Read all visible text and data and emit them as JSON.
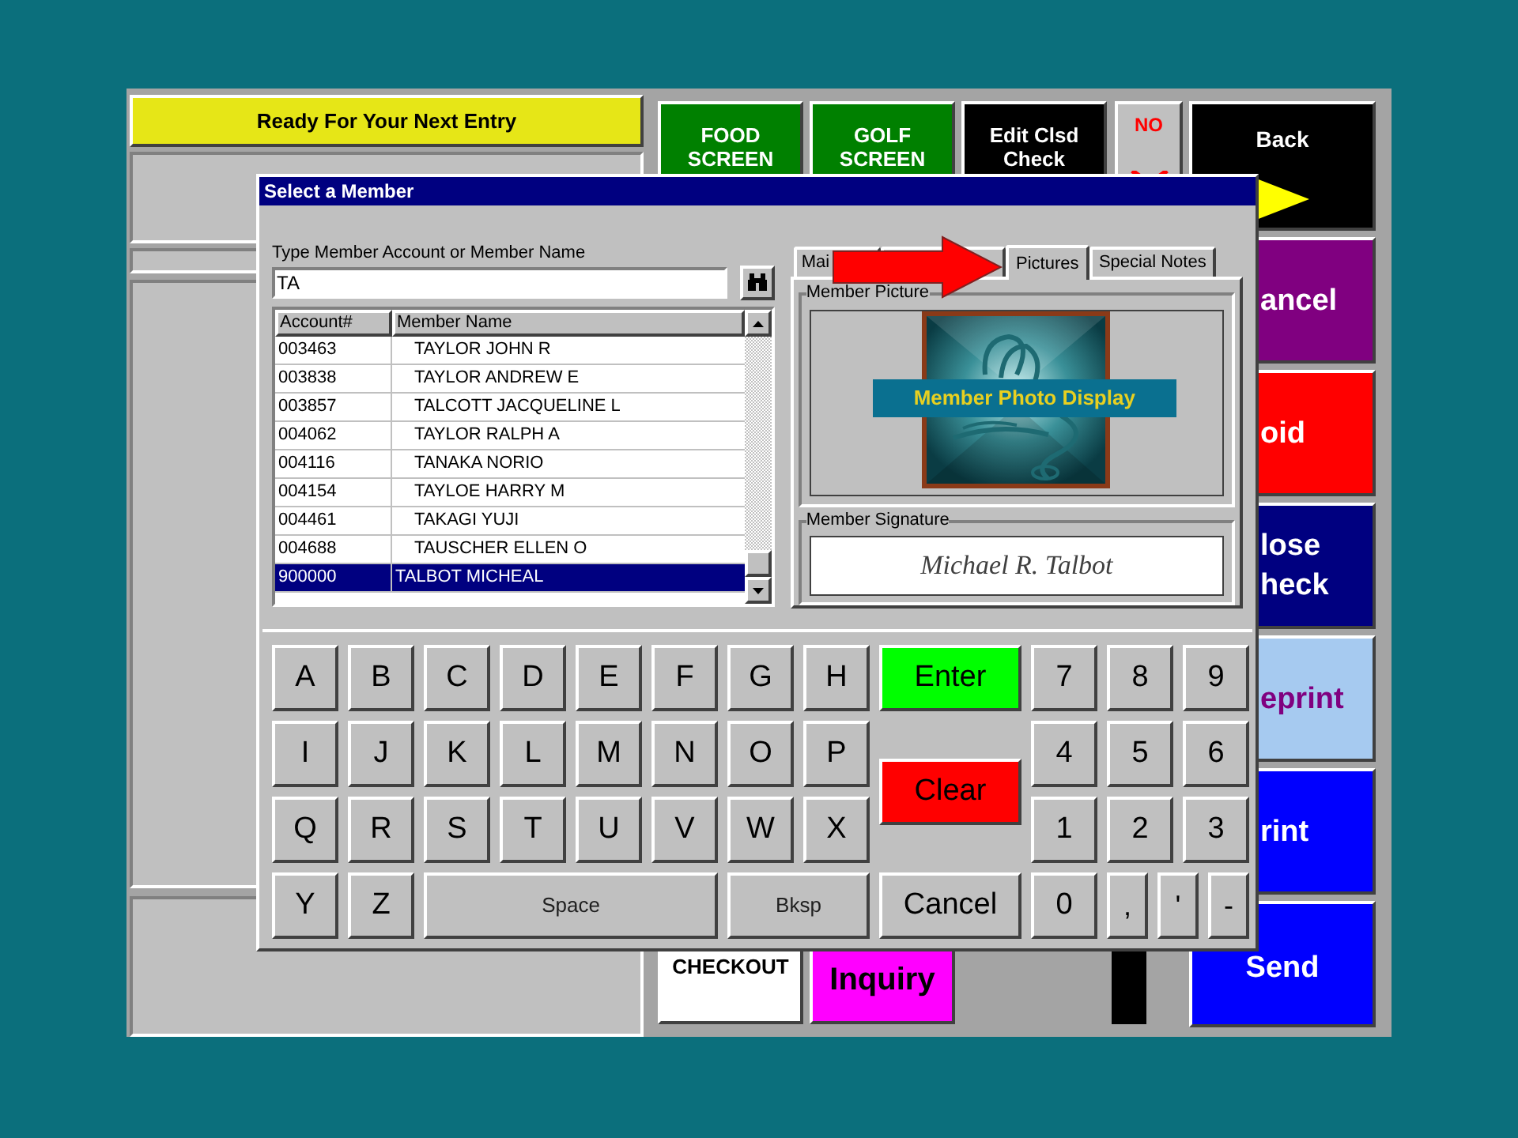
{
  "status": "Ready For Your Next Entry",
  "top_buttons": [
    {
      "lines": [
        "FOOD",
        "SCREEN"
      ],
      "kind": "green"
    },
    {
      "lines": [
        "GOLF",
        "SCREEN"
      ],
      "kind": "green"
    },
    {
      "lines": [
        "Edit Clsd",
        "Check"
      ],
      "kind": "black"
    }
  ],
  "no_button": {
    "label": "NO"
  },
  "back_button": {
    "label": "Back"
  },
  "side_buttons": [
    {
      "lines": [
        "ancel"
      ],
      "kind": "purple",
      "cut": true
    },
    {
      "lines": [
        "oid"
      ],
      "kind": "red",
      "cut": true
    },
    {
      "lines": [
        "lose",
        "heck"
      ],
      "kind": "navy",
      "cut": true
    },
    {
      "lines": [
        "eprint"
      ],
      "kind": "light",
      "cut": true
    },
    {
      "lines": [
        "rint"
      ],
      "kind": "blue",
      "cut": true
    },
    {
      "lines": [
        "Send"
      ],
      "kind": "blue",
      "cut": false
    }
  ],
  "bottom_buttons": [
    {
      "lines": [
        "CHECKOUT"
      ],
      "kind": "white"
    },
    {
      "lines": [
        "Inquiry"
      ],
      "kind": "magenta"
    }
  ],
  "dialog": {
    "title": "Select a Member",
    "search": {
      "label": "Type Member Account or Member Name",
      "value": "TA"
    },
    "table": {
      "columns": [
        "Account#",
        "Member Name"
      ],
      "rows": [
        {
          "account": "003463",
          "name": "TAYLOR JOHN R",
          "selected": false
        },
        {
          "account": "003838",
          "name": "TAYLOR ANDREW E",
          "selected": false
        },
        {
          "account": "003857",
          "name": "TALCOTT JACQUELINE L",
          "selected": false
        },
        {
          "account": "004062",
          "name": "TAYLOR RALPH A",
          "selected": false
        },
        {
          "account": "004116",
          "name": "TANAKA NORIO",
          "selected": false
        },
        {
          "account": "004154",
          "name": "TAYLOE HARRY M",
          "selected": false
        },
        {
          "account": "004461",
          "name": "TAKAGI YUJI",
          "selected": false
        },
        {
          "account": "004688",
          "name": "TAUSCHER ELLEN O",
          "selected": false
        },
        {
          "account": "900000",
          "name": "TALBOT MICHEAL",
          "selected": true
        }
      ]
    },
    "tabs": [
      {
        "label": "Mai",
        "selected": false
      },
      {
        "selected": false
      },
      {
        "label": "Pictures",
        "selected": true
      },
      {
        "label": "Special Notes",
        "selected": false
      }
    ],
    "picture_group": {
      "label": "Member Picture",
      "overlay": "Member Photo Display"
    },
    "signature_group": {
      "label": "Member Signature",
      "signature": "Michael R. Talbot"
    },
    "keyboard": {
      "letters": [
        [
          {
            "label": "A",
            "kind": "key"
          },
          {
            "label": "B",
            "kind": "key"
          },
          {
            "label": "C",
            "kind": "key"
          },
          {
            "label": "D",
            "kind": "key"
          },
          {
            "label": "E",
            "kind": "key"
          },
          {
            "label": "F",
            "kind": "key"
          },
          {
            "label": "G",
            "kind": "key"
          },
          {
            "label": "H",
            "kind": "key"
          }
        ],
        [
          {
            "label": "I",
            "kind": "key"
          },
          {
            "label": "J",
            "kind": "key"
          },
          {
            "label": "K",
            "kind": "key"
          },
          {
            "label": "L",
            "kind": "key"
          },
          {
            "label": "M",
            "kind": "key"
          },
          {
            "label": "N",
            "kind": "key"
          },
          {
            "label": "O",
            "kind": "key"
          },
          {
            "label": "P",
            "kind": "key"
          }
        ],
        [
          {
            "label": "Q",
            "kind": "key"
          },
          {
            "label": "R",
            "kind": "key"
          },
          {
            "label": "S",
            "kind": "key"
          },
          {
            "label": "T",
            "kind": "key"
          },
          {
            "label": "U",
            "kind": "key"
          },
          {
            "label": "V",
            "kind": "key"
          },
          {
            "label": "W",
            "kind": "key"
          },
          {
            "label": "X",
            "kind": "key"
          }
        ],
        [
          {
            "label": "Y",
            "kind": "key"
          },
          {
            "label": "Z",
            "kind": "key"
          },
          {
            "label": "Space",
            "kind": "space"
          },
          {
            "label": "Bksp",
            "kind": "bksp"
          }
        ]
      ],
      "actions": [
        {
          "label": "Enter",
          "kind": "enter"
        },
        {
          "label": "Clear",
          "kind": "clear"
        },
        {
          "label": "Cancel",
          "kind": "cancel"
        }
      ],
      "numbers": [
        [
          {
            "label": "7",
            "kind": "key"
          },
          {
            "label": "8",
            "kind": "key"
          },
          {
            "label": "9",
            "kind": "key"
          }
        ],
        [
          {
            "label": "4",
            "kind": "key"
          },
          {
            "label": "5",
            "kind": "key"
          },
          {
            "label": "6",
            "kind": "key"
          }
        ],
        [
          {
            "label": "1",
            "kind": "key"
          },
          {
            "label": "2",
            "kind": "key"
          },
          {
            "label": "3",
            "kind": "key"
          }
        ],
        [
          {
            "label": "0",
            "kind": "key"
          },
          {
            "label": ",",
            "kind": "small"
          },
          {
            "label": "'",
            "kind": "small"
          },
          {
            "label": "-",
            "kind": "small"
          }
        ]
      ]
    }
  }
}
